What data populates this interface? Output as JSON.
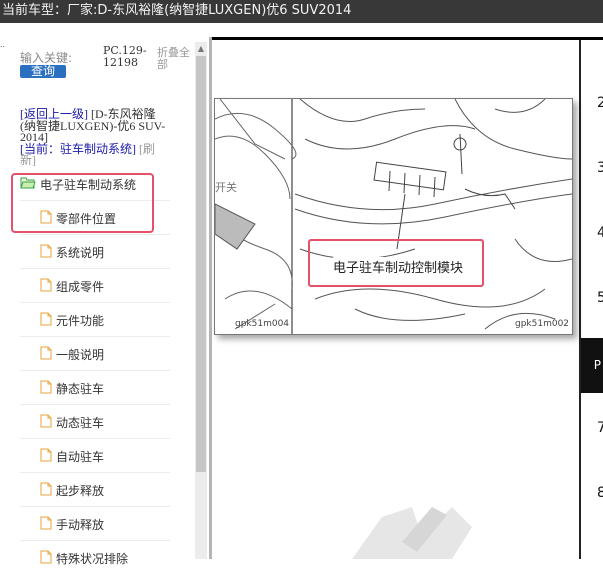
{
  "header": {
    "prefix": "当前车型：",
    "vehicle": "厂家:D-东风裕隆(纳智捷LUXGEN)优6 SUV2014"
  },
  "sidebar": {
    "dots": "..",
    "keyword_label": "输入关键:",
    "query_button": "查询",
    "code_lines": [
      "PC.129-",
      "12198"
    ],
    "collapse_all": "折叠全部",
    "nav": {
      "back_link": "[返回上一级]",
      "back_target_line1": "[D-东风裕隆",
      "back_target_line2": "(纳智捷LUXGEN)-优6 SUV-",
      "back_target_line3": "2014]",
      "current_label": "[当前：驻车制动系统]",
      "refresh_line1": "[刷",
      "refresh_line2": "新]"
    },
    "tree": [
      {
        "label": "电子驻车制动系统",
        "type": "folder"
      },
      {
        "label": "零部件位置",
        "type": "doc"
      },
      {
        "label": "系统说明",
        "type": "doc"
      },
      {
        "label": "组成零件",
        "type": "doc"
      },
      {
        "label": "元件功能",
        "type": "doc"
      },
      {
        "label": "一般说明",
        "type": "doc"
      },
      {
        "label": "静态驻车",
        "type": "doc"
      },
      {
        "label": "动态驻车",
        "type": "doc"
      },
      {
        "label": "自动驻车",
        "type": "doc"
      },
      {
        "label": "起步释放",
        "type": "doc"
      },
      {
        "label": "手动释放",
        "type": "doc"
      },
      {
        "label": "特殊状况排除",
        "type": "doc"
      }
    ]
  },
  "content": {
    "diagram": {
      "left_label": "开关",
      "module_label": "电子驻车制动控制模块",
      "left_code": "gpk51m004",
      "right_code": "gpk51m002"
    },
    "side_numbers": [
      "2",
      "3",
      "4",
      "5",
      "7",
      "8"
    ],
    "dark_tab_text": "P"
  },
  "colors": {
    "header_bg": "#383838",
    "query_button": "#2b6fc0",
    "highlight_red": "#e8506a",
    "link_blue": "#1a1aaa"
  }
}
